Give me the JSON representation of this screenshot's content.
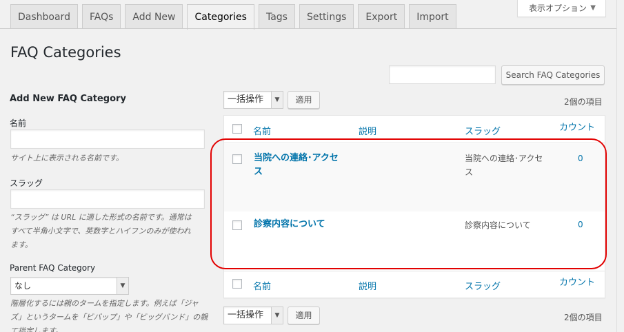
{
  "tabs": [
    {
      "label": "Dashboard"
    },
    {
      "label": "FAQs"
    },
    {
      "label": "Add New"
    },
    {
      "label": "Categories",
      "active": true
    },
    {
      "label": "Tags"
    },
    {
      "label": "Settings"
    },
    {
      "label": "Export"
    },
    {
      "label": "Import"
    }
  ],
  "screen_options": {
    "label": "表示オプション",
    "arrow": "▼"
  },
  "page_title": "FAQ Categories",
  "search": {
    "button_label": "Search FAQ Categories",
    "placeholder": ""
  },
  "form": {
    "heading": "Add New FAQ Category",
    "name_label": "名前",
    "name_desc": "サイト上に表示される名前です。",
    "slug_label": "スラッグ",
    "slug_desc_lines": [
      "“スラッグ” は URL に適した形式の名前です。通常は",
      "すべて半角小文字で、英数字とハイフンのみが使われ",
      "ます。"
    ],
    "parent_label": "Parent FAQ Category",
    "parent_value": "なし",
    "parent_desc_lines": [
      "階層化するには親のタームを指定します。例えば「ジャ",
      "ズ」というタームを「ビバップ」や「ビッグバンド」の親とし",
      "て指定します。"
    ]
  },
  "bulk": {
    "label": "一括操作",
    "apply_label": "適用"
  },
  "item_count": "2個の項目",
  "table": {
    "headers": {
      "name": "名前",
      "description": "説明",
      "slug": "スラッグ",
      "count": "カウント"
    },
    "rows": [
      {
        "name": "当院への連絡･アクセス",
        "description": "",
        "slug": "当院への連絡･アクセス",
        "count": "0"
      },
      {
        "name": "診察内容について",
        "description": "",
        "slug": "診察内容について",
        "count": "0"
      }
    ]
  },
  "colors": {
    "link": "#0073aa",
    "highlight": "#e20000",
    "background": "#f1f1f1"
  }
}
